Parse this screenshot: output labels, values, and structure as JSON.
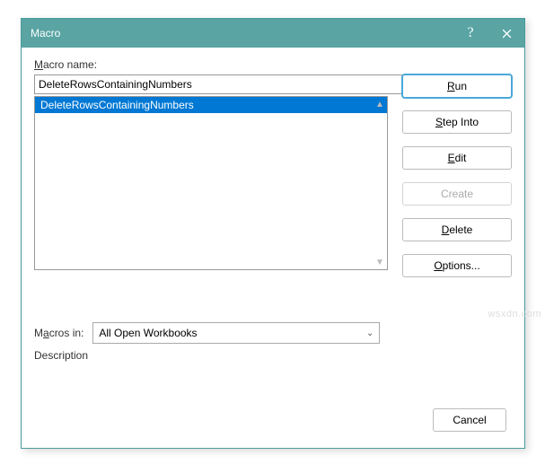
{
  "dialog": {
    "title": "Macro",
    "help": "?",
    "name_label_pre": "M",
    "name_label_post": "acro name:",
    "name_value": "DeleteRowsContainingNumbers",
    "list_items": [
      "DeleteRowsContainingNumbers"
    ],
    "macros_in_label_pre": "M",
    "macros_in_label_u": "a",
    "macros_in_label_post": "cros in:",
    "macros_in_value": "All Open Workbooks",
    "description_label": "Description"
  },
  "buttons": {
    "run_u": "R",
    "run_post": "un",
    "step_u": "S",
    "step_post": "tep Into",
    "edit_u": "E",
    "edit_post": "dit",
    "create_pre": "",
    "create_u": "C",
    "create_post": "reate",
    "delete_u": "D",
    "delete_post": "elete",
    "options_u": "O",
    "options_post": "ptions...",
    "cancel": "Cancel"
  },
  "watermark": "wsxdn.com"
}
